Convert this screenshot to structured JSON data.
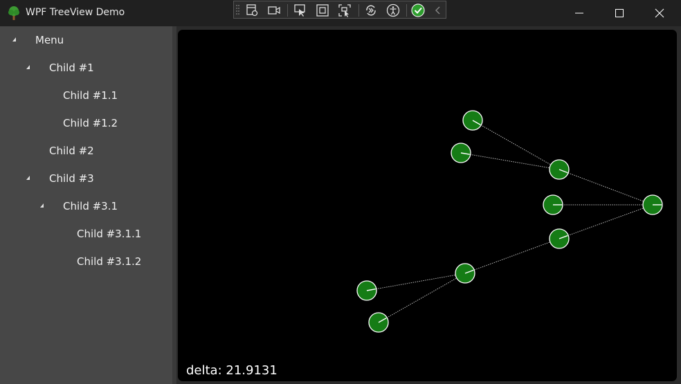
{
  "window": {
    "title": "WPF TreeView Demo"
  },
  "toolbar": {
    "icons": [
      "grip-icon",
      "live-visual-tree-icon",
      "record-icon",
      "select-element-icon",
      "display-layout-adorners-icon",
      "track-focus-icon",
      "hot-reload-icon",
      "accessibility-icon",
      "binding-failures-check-icon",
      "collapse-chevron-icon"
    ]
  },
  "tree": {
    "items": [
      {
        "label": "Menu",
        "expanded": true
      },
      {
        "label": "Child #1",
        "expanded": true
      },
      {
        "label": "Child #1.1",
        "expanded": false
      },
      {
        "label": "Child #1.2",
        "expanded": false
      },
      {
        "label": "Child #2",
        "expanded": false
      },
      {
        "label": "Child #3",
        "expanded": true
      },
      {
        "label": "Child #3.1",
        "expanded": true
      },
      {
        "label": "Child #3.1.1",
        "expanded": false
      },
      {
        "label": "Child #3.1.2",
        "expanded": false
      }
    ]
  },
  "graph": {
    "node_color": "#157c15",
    "node_stroke": "#ffffff",
    "edge_color": "#bbbbbb",
    "delta_text": "delta: 21.9131"
  },
  "colors": {
    "titlebar": "#202020",
    "sidebar": "#474747",
    "canvas": "#000000"
  }
}
